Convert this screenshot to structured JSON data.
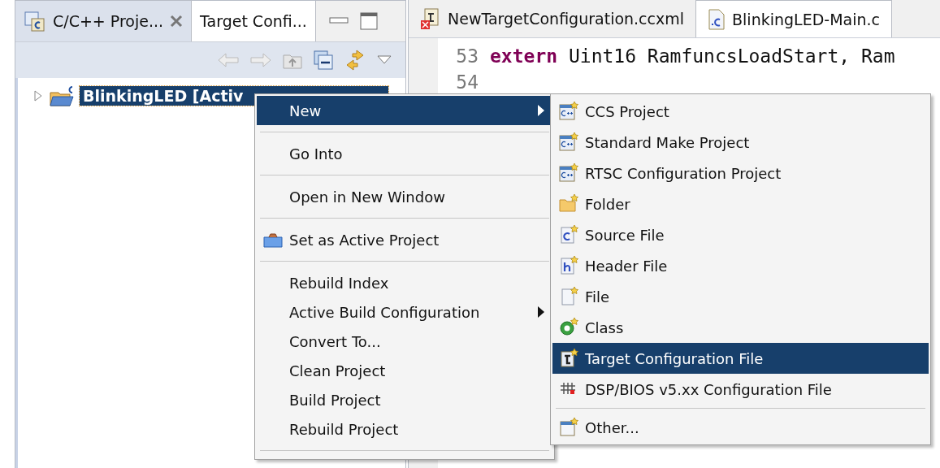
{
  "left_pane": {
    "tabs": [
      {
        "label": "C/C++ Proje...",
        "selected": true,
        "closable": true
      },
      {
        "label": "Target Confi...",
        "selected": false,
        "closable": false
      }
    ],
    "tree": [
      {
        "label": "BlinkingLED [Activ",
        "selected": true,
        "expanded": false
      }
    ]
  },
  "editor": {
    "tabs": [
      {
        "label": "NewTargetConfiguration.ccxml",
        "selected": false
      },
      {
        "label": "BlinkingLED-Main.c",
        "selected": true
      }
    ],
    "lines": [
      {
        "number": "53",
        "tokens": [
          {
            "kind": "keyword",
            "text": "extern"
          },
          {
            "kind": "plain",
            "text": " Uint16 RamfuncsLoadStart, Ram"
          }
        ]
      },
      {
        "number": "54"
      }
    ]
  },
  "context_menu": {
    "items": [
      {
        "kind": "item",
        "label": "New",
        "selected": true,
        "submenu": true
      },
      {
        "kind": "separator"
      },
      {
        "kind": "item",
        "label": "Go Into",
        "selected": false,
        "submenu": false
      },
      {
        "kind": "separator"
      },
      {
        "kind": "item",
        "label": "Open in New Window",
        "selected": false,
        "submenu": false
      },
      {
        "kind": "separator"
      },
      {
        "kind": "project",
        "label": "Set as Active Project",
        "selected": false,
        "submenu": false
      },
      {
        "kind": "separator"
      },
      {
        "kind": "item",
        "label": "Rebuild Index",
        "selected": false,
        "submenu": false
      },
      {
        "kind": "item",
        "label": "Active Build Configuration",
        "selected": false,
        "submenu": true
      },
      {
        "kind": "item",
        "label": "Convert To...",
        "selected": false,
        "submenu": false
      },
      {
        "kind": "item",
        "label": "Clean Project",
        "selected": false,
        "submenu": false
      },
      {
        "kind": "item",
        "label": "Build Project",
        "selected": false,
        "submenu": false
      },
      {
        "kind": "item",
        "label": "Rebuild Project",
        "selected": false,
        "submenu": false
      },
      {
        "kind": "separator"
      }
    ]
  },
  "submenu": {
    "items": [
      {
        "kind": "project",
        "label": "CCS Project",
        "selected": false
      },
      {
        "kind": "project",
        "label": "Standard Make Project",
        "selected": false
      },
      {
        "kind": "project",
        "label": "RTSC Configuration Project",
        "selected": false
      },
      {
        "kind": "folder",
        "label": "Folder",
        "selected": false
      },
      {
        "kind": "source",
        "label": "Source File",
        "selected": false
      },
      {
        "kind": "header",
        "label": "Header File",
        "selected": false
      },
      {
        "kind": "file",
        "label": "File",
        "selected": false
      },
      {
        "kind": "class",
        "label": "Class",
        "selected": false
      },
      {
        "kind": "target",
        "label": "Target Configuration File",
        "selected": true
      },
      {
        "kind": "dsp",
        "label": "DSP/BIOS v5.xx Configuration File",
        "selected": false
      },
      {
        "kind": "separator"
      },
      {
        "kind": "other",
        "label": "Other...",
        "selected": false
      }
    ]
  }
}
